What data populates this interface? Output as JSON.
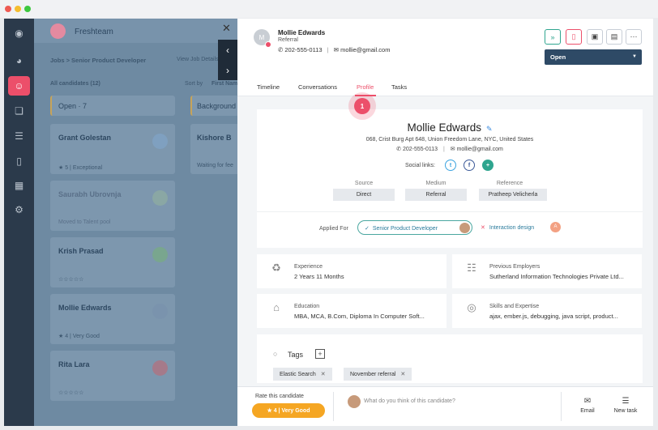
{
  "background": {
    "app_name": "Freshteam",
    "breadcrumb": "Jobs  >  Senior Product Developer",
    "view_job": "View Job Details",
    "filter": "All candidates (12)",
    "sort_by": "Sort by",
    "sort_value": "First Name",
    "col1_title": "Open  · 7",
    "col2_title": "Background",
    "cards": [
      {
        "name": "Grant Golestan",
        "sub": "★ 5 | Exceptional"
      },
      {
        "name": "Saurabh Ubrovnja",
        "sub": "Moved to Talent pool"
      },
      {
        "name": "Krish Prasad",
        "sub": "☆☆☆☆☆"
      },
      {
        "name": "Mollie Edwards",
        "sub": "★ 4 | Very Good"
      },
      {
        "name": "Rita Lara",
        "sub": "☆☆☆☆☆"
      }
    ],
    "col2_cards": [
      {
        "name": "Kishore B",
        "sub": "Waiting for fee"
      }
    ]
  },
  "header": {
    "avatar_initial": "M",
    "name": "Mollie Edwards",
    "source": "Referral",
    "phone": "202-555-0113",
    "email": "mollie@gmail.com",
    "status": "Open"
  },
  "tabs": [
    "Timeline",
    "Conversations",
    "Profile",
    "Tasks"
  ],
  "step_number": "1",
  "profile": {
    "name": "Mollie Edwards",
    "address": "068, Crist Burg Apt 648, Union Freedom Lane,  NYC,  United States",
    "phone": "202-555-0113",
    "email": "mollie@gmail.com",
    "social_label": "Social links:",
    "source_label": "Source",
    "source_value": "Direct",
    "medium_label": "Medium",
    "medium_value": "Referral",
    "reference_label": "Reference",
    "reference_value": "Pratheep Velicherla"
  },
  "applied": {
    "label": "Applied For",
    "job1": "Senior Product Developer",
    "job2": "Interaction design",
    "job2_avatar": "A"
  },
  "info": {
    "experience_title": "Experience",
    "experience_value": "2 Years 11 Months",
    "employers_title": "Previous Employers",
    "employers_value": "Sutherland Information Technologies Private Ltd...",
    "education_title": "Education",
    "education_value": "MBA,  MCA,  B.Com,  Diploma In Computer Soft...",
    "skills_title": "Skills and Expertise",
    "skills_value": "ajax,  ember.js,  debugging,  java script,  product..."
  },
  "tags": {
    "title": "Tags",
    "items": [
      "Elastic Search",
      "November referral"
    ]
  },
  "footer": {
    "rate_label": "Rate this candidate",
    "rating": "★  4 | Very Good",
    "comment_placeholder": "What do you think of this candidate?",
    "email": "Email",
    "new_task": "New task"
  },
  "colors": {
    "accent": "#ec4f6a",
    "primary_dark": "#2e4a66",
    "rating": "#f5a623",
    "rail": "#2b3a4b"
  }
}
